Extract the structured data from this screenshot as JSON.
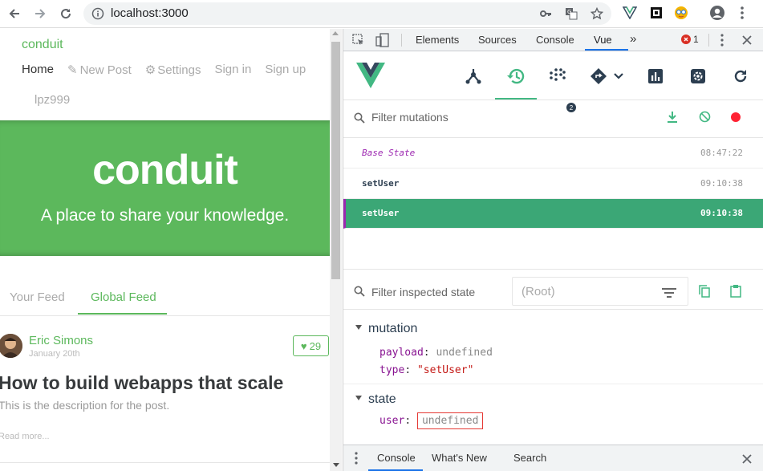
{
  "browser": {
    "url": "localhost:3000",
    "icons": [
      "back-arrow-icon",
      "forward-arrow-icon",
      "reload-icon",
      "info-icon",
      "key-icon",
      "translate-icon",
      "star-icon",
      "vue-ext-icon",
      "qr-ext-icon",
      "face-ext-icon",
      "profile-icon",
      "more-vert-icon"
    ]
  },
  "app": {
    "brand": "conduit",
    "nav": {
      "home": "Home",
      "new_post": "New Post",
      "settings": "Settings",
      "sign_in": "Sign in",
      "sign_up": "Sign up"
    },
    "username": "lpz999",
    "banner": {
      "logo": "conduit",
      "tagline": "A place to share your knowledge."
    },
    "feed_tabs": {
      "your_feed": "Your Feed",
      "global_feed": "Global Feed"
    },
    "article": {
      "author": "Eric Simons",
      "date": "January 20th",
      "favorites": "29",
      "title": "How to build webapps that scale",
      "description": "This is the description for the post.",
      "read_more": "Read more..."
    },
    "colors": {
      "primary": "#5cb85c"
    }
  },
  "devtools": {
    "tabs": [
      "Elements",
      "Sources",
      "Console",
      "Vue"
    ],
    "active_tab": "Vue",
    "error_count": "1",
    "vue": {
      "icons": [
        "vue-logo-icon",
        "components-icon",
        "history-icon",
        "vuex-icon",
        "events-icon",
        "router-icon",
        "performance-icon",
        "settings-icon",
        "refresh-icon"
      ],
      "events_badge": "2",
      "filter_mutations_placeholder": "Filter mutations",
      "mutations": [
        {
          "name": "Base State",
          "time": "08:47:22"
        },
        {
          "name": "setUser",
          "time": "09:10:38"
        },
        {
          "name": "setUser",
          "time": "09:10:38"
        }
      ],
      "filter_state_placeholder": "Filter inspected state",
      "root_selector": "(Root)",
      "mutation_section": {
        "title": "mutation",
        "payload_key": "payload",
        "payload_value": "undefined",
        "type_key": "type",
        "type_value": "\"setUser\""
      },
      "state_section": {
        "title": "state",
        "user_key": "user",
        "user_value": "undefined"
      },
      "colors": {
        "accent": "#42b883",
        "selected_row": "#3ba776"
      }
    },
    "drawer": {
      "tabs": [
        "Console",
        "What's New",
        "Search"
      ]
    }
  }
}
